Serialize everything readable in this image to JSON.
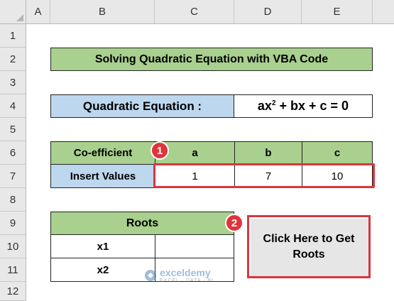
{
  "columns": [
    "A",
    "B",
    "C",
    "D",
    "E"
  ],
  "rows": [
    "1",
    "2",
    "3",
    "4",
    "5",
    "6",
    "7",
    "8",
    "9",
    "10",
    "11",
    "12"
  ],
  "title": "Solving Quadratic Equation with VBA Code",
  "equation_label": "Quadratic Equation :",
  "equation": {
    "pre": "ax",
    "sup": "2",
    "post": " + bx + c = 0"
  },
  "coeff_table": {
    "header_label": "Co-efficient",
    "headers": [
      "a",
      "b",
      "c"
    ],
    "row_label": "Insert Values",
    "values": [
      "1",
      "7",
      "10"
    ]
  },
  "roots_table": {
    "header": "Roots",
    "rows": [
      {
        "label": "x1",
        "value": ""
      },
      {
        "label": "x2",
        "value": ""
      }
    ]
  },
  "button_label": "Click Here to Get Roots",
  "badges": [
    "1",
    "2"
  ],
  "watermark": {
    "name": "exceldemy",
    "tagline": "EXCEL · DATA · BI"
  },
  "colors": {
    "green": "#a9d08e",
    "blue": "#bdd7ee",
    "accent_red": "#d9363e"
  }
}
